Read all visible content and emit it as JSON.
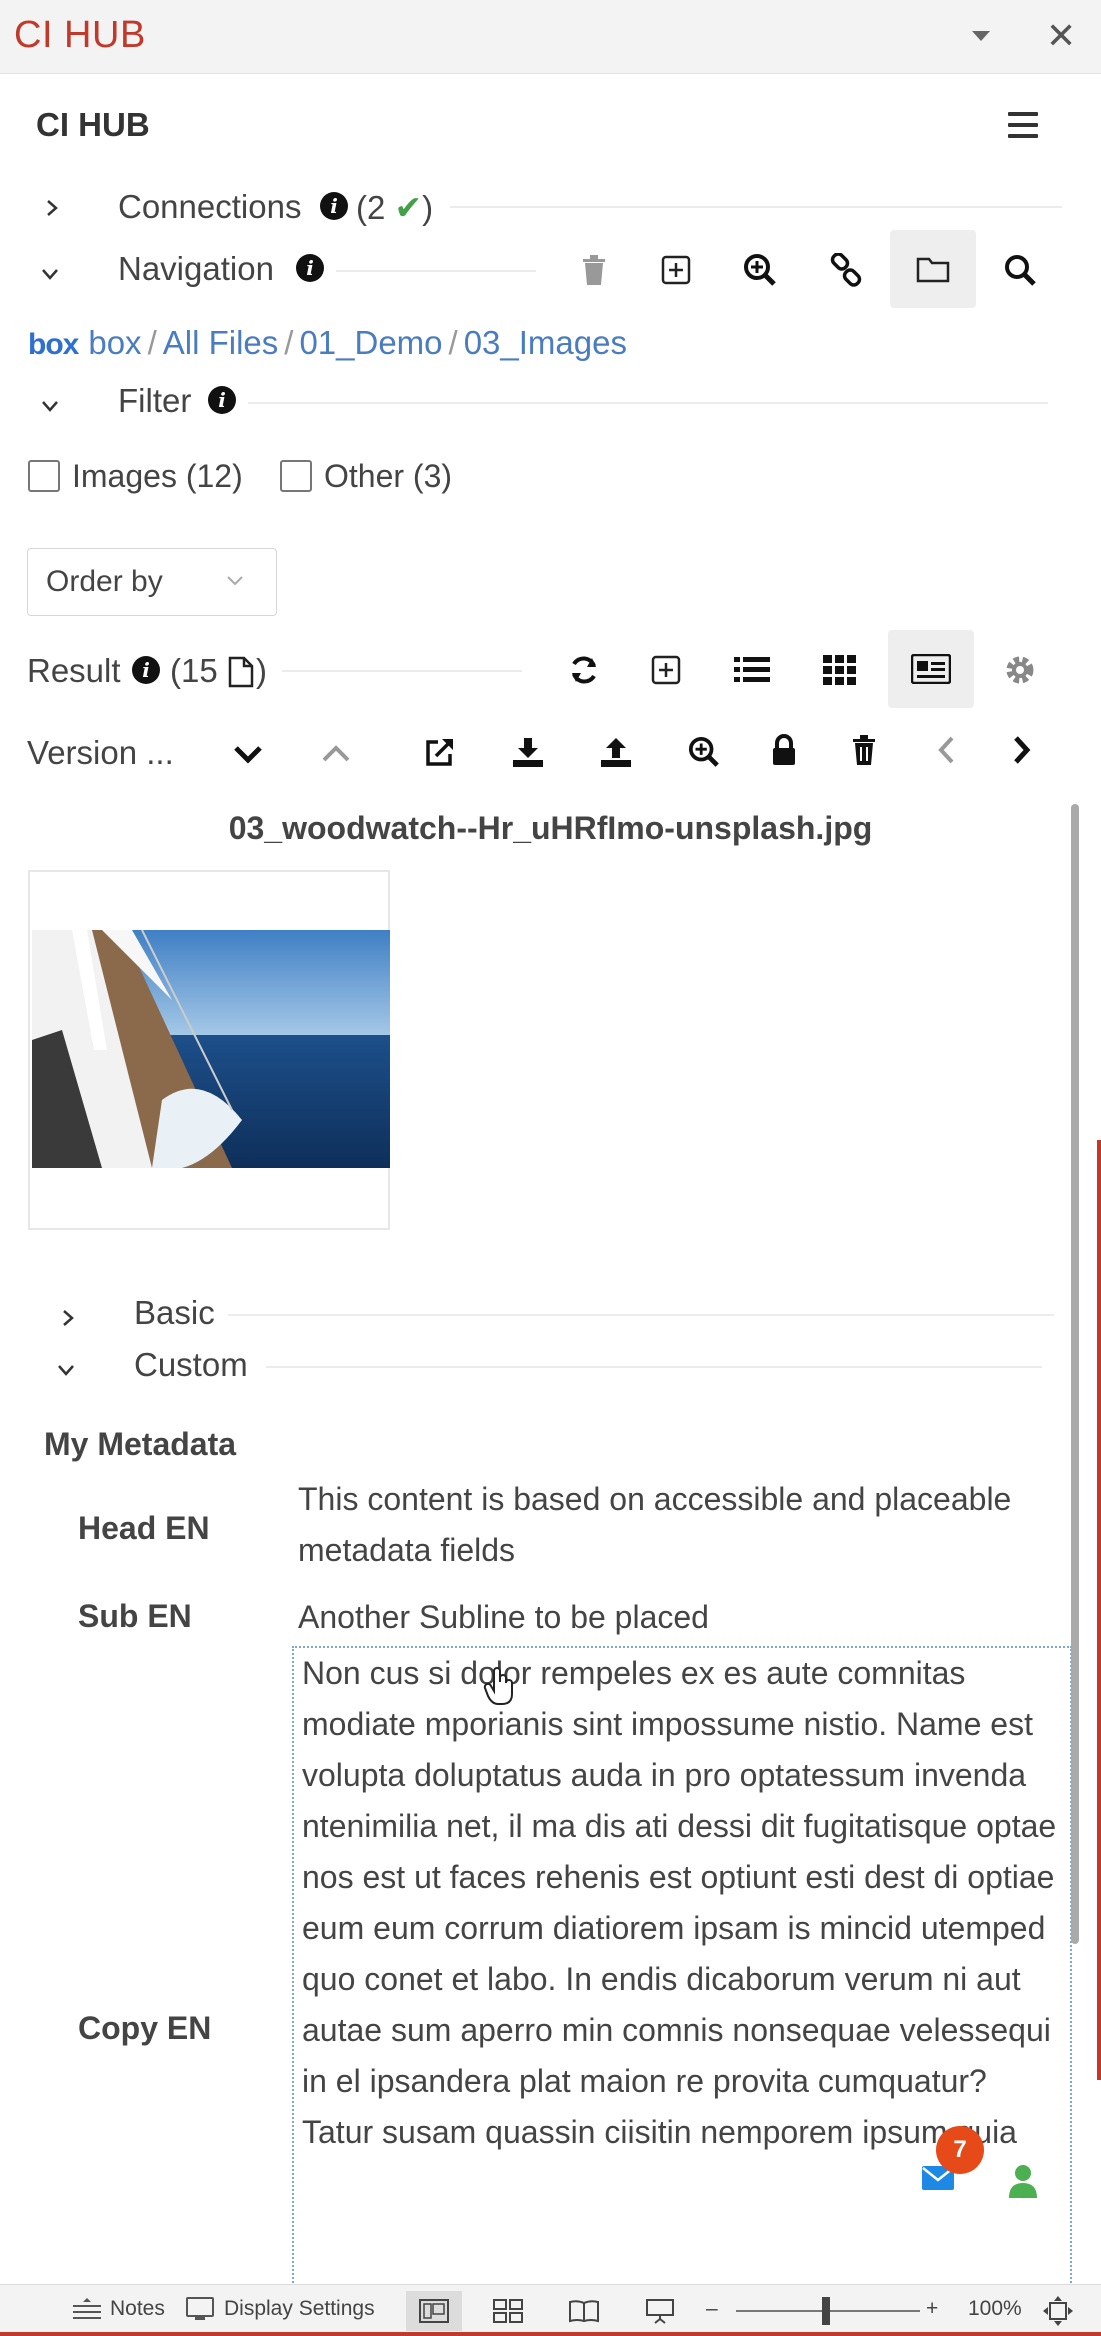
{
  "panel": {
    "title": "CI HUB"
  },
  "app": {
    "title": "CI HUB"
  },
  "connections": {
    "label": "Connections",
    "count_prefix": "(2",
    "check": "✔",
    "count_suffix": ")"
  },
  "navigation": {
    "label": "Navigation"
  },
  "breadcrumb": {
    "logo": "box",
    "items": [
      "box",
      "All Files",
      "01_Demo",
      "03_Images"
    ],
    "separator": "/"
  },
  "filter": {
    "label": "Filter",
    "options": [
      {
        "label": "Images (12)",
        "checked": false
      },
      {
        "label": "Other (3)",
        "checked": false
      }
    ]
  },
  "order_by": {
    "label": "Order by"
  },
  "result": {
    "label": "Result",
    "count_prefix": "(15",
    "count_suffix": ")"
  },
  "version": {
    "label": "Version ..."
  },
  "asset": {
    "filename": "03_woodwatch--Hr_uHRfImo-unsplash.jpg"
  },
  "sections": {
    "basic": "Basic",
    "custom": "Custom"
  },
  "metadata": {
    "title": "My Metadata",
    "fields": [
      {
        "key": "Head EN",
        "value": "This content is based on accessible and placeable metadata fields"
      },
      {
        "key": "Sub EN",
        "value": "Another Subline to be placed"
      },
      {
        "key": "Copy EN",
        "value": "Non cus si dolor rempeles ex es aute comnitas modiate mporianis sint impossume nistio. Name est volupta doluptatus auda in pro optatessum invenda ntenimilia net, il ma dis ati dessi dit fugitatisque optae nos est ut faces rehenis est optiunt esti dest di optiae eum eum corrum diatiorem ipsam is mincid utemped quo conet et labo. In endis dicaborum verum ni aut autae sum aperro min comnis nonsequae velessequi in el ipsandera plat maion re provita cumquatur? Tatur susam quassin ciisitin nemporem ipsum quia"
      }
    ]
  },
  "notifications": {
    "count": "7"
  },
  "statusbar": {
    "notes": "Notes",
    "display_settings": "Display Settings",
    "zoom": "100%",
    "zoom_minus": "–",
    "zoom_plus": "+"
  },
  "colors": {
    "brand": "#c0392b",
    "link": "#4a7cc0",
    "check": "#43a047",
    "badge": "#e64a19",
    "user": "#4caf50",
    "mail": "#1e88e5"
  }
}
